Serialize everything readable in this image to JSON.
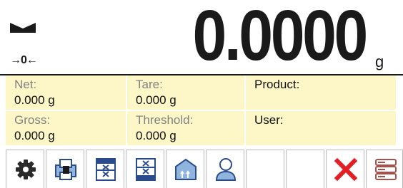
{
  "display": {
    "reading": "0.0000",
    "unit": "g",
    "zero_indicator": "→0←",
    "stability_icon": "stable-indicator-icon"
  },
  "info": {
    "net": {
      "label": "Net:",
      "value": "0.000 g"
    },
    "tare": {
      "label": "Tare:",
      "value": "0.000 g"
    },
    "product": {
      "label": "Product:"
    },
    "gross": {
      "label": "Gross:",
      "value": "0.000 g"
    },
    "threshold": {
      "label": "Threshold:",
      "value": "0.000 g"
    },
    "user": {
      "label": "User:"
    }
  },
  "toolbar": {
    "buttons": [
      {
        "icon": "settings-gear-icon"
      },
      {
        "icon": "printer-icon"
      },
      {
        "icon": "threshold-icon"
      },
      {
        "icon": "threshold-icon"
      },
      {
        "icon": "product-database-icon"
      },
      {
        "icon": "user-icon"
      },
      {
        "icon": ""
      },
      {
        "icon": ""
      },
      {
        "icon": "cancel-x-icon"
      },
      {
        "icon": "database-icon"
      }
    ]
  },
  "colors": {
    "info_background": "#fdf6c6",
    "label_text": "#828282",
    "accent_blue": "#2b4c8c",
    "light_blue": "#8fb4dd",
    "cancel_red": "#e31e24",
    "database_red": "#a9504a"
  }
}
